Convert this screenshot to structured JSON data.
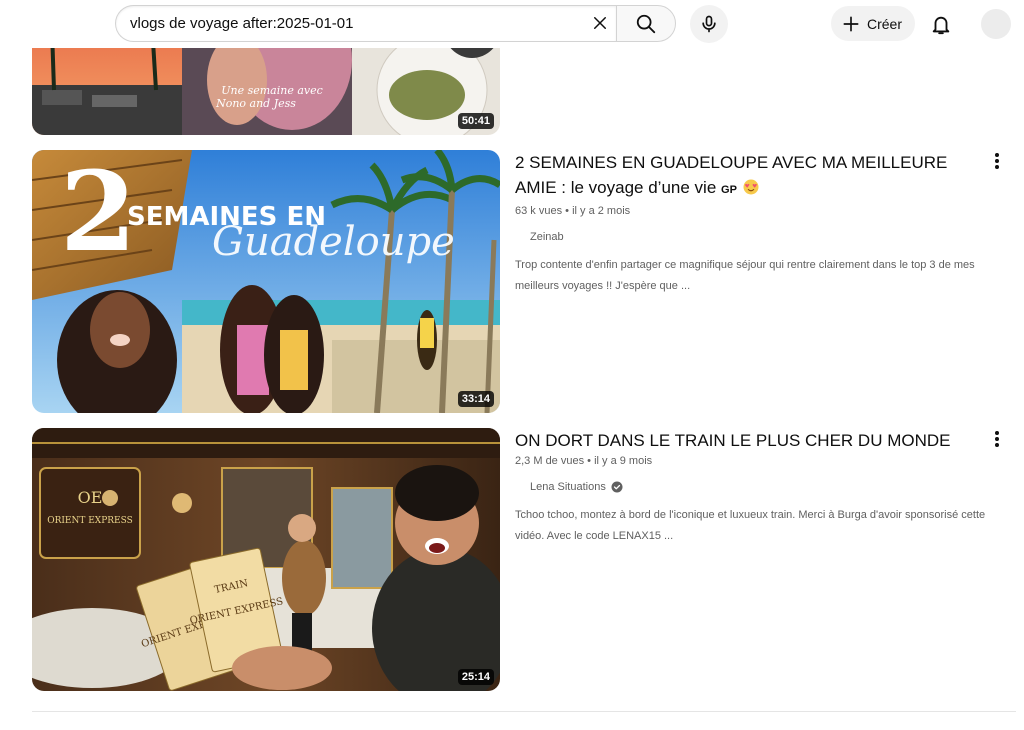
{
  "search": {
    "query": "vlogs de voyage after:2025-01-01"
  },
  "header": {
    "create_label": "Créer"
  },
  "icons": {
    "clear": "close-icon",
    "search": "search-icon",
    "mic": "mic-icon",
    "create": "plus-icon",
    "notifications": "bell-icon",
    "more": "more-vert-icon",
    "verified": "verified-check-icon"
  },
  "colors": {
    "accent": "#0f0f0f",
    "secondary_text": "#606060",
    "heart_eyes": "#f0506e"
  },
  "results": [
    {
      "duration": "50:41",
      "overlay_text_1": "Une semaine avec",
      "overlay_text_2": "Nono and Jess"
    },
    {
      "title_main": "2 SEMAINES EN GUADELOUPE AVEC MA MEILLEURE AMIE : le voyage d’une vie",
      "title_badge": "GP",
      "views": "63 k vues",
      "age": "il y a 2 mois",
      "channel": "Zeinab",
      "description": "Trop contente d'enfin partager ce magnifique séjour qui rentre clairement dans le top 3 de mes meilleurs voyages !! J'espère que ...",
      "duration": "33:14",
      "thumb_text_number": "2",
      "thumb_text_line1": "SEMAINES EN",
      "thumb_text_line2": "Guadeloupe"
    },
    {
      "title_main": "ON DORT DANS LE TRAIN LE PLUS CHER DU MONDE",
      "views": "2,3 M de vues",
      "age": "il y a 9 mois",
      "channel": "Lena Situations",
      "description": "Tchoo tchoo, montez à bord de l'iconique et luxueux train. Merci à Burga d'avoir sponsorisé cette vidéo. Avec le code LENAX15 ...",
      "duration": "25:14",
      "thumb_sign_1": "OE",
      "thumb_sign_2": "ORIENT EXPRESS",
      "thumb_ticket_1": "ORIENT EXPRESS",
      "thumb_ticket_2": "TRAIN"
    }
  ]
}
